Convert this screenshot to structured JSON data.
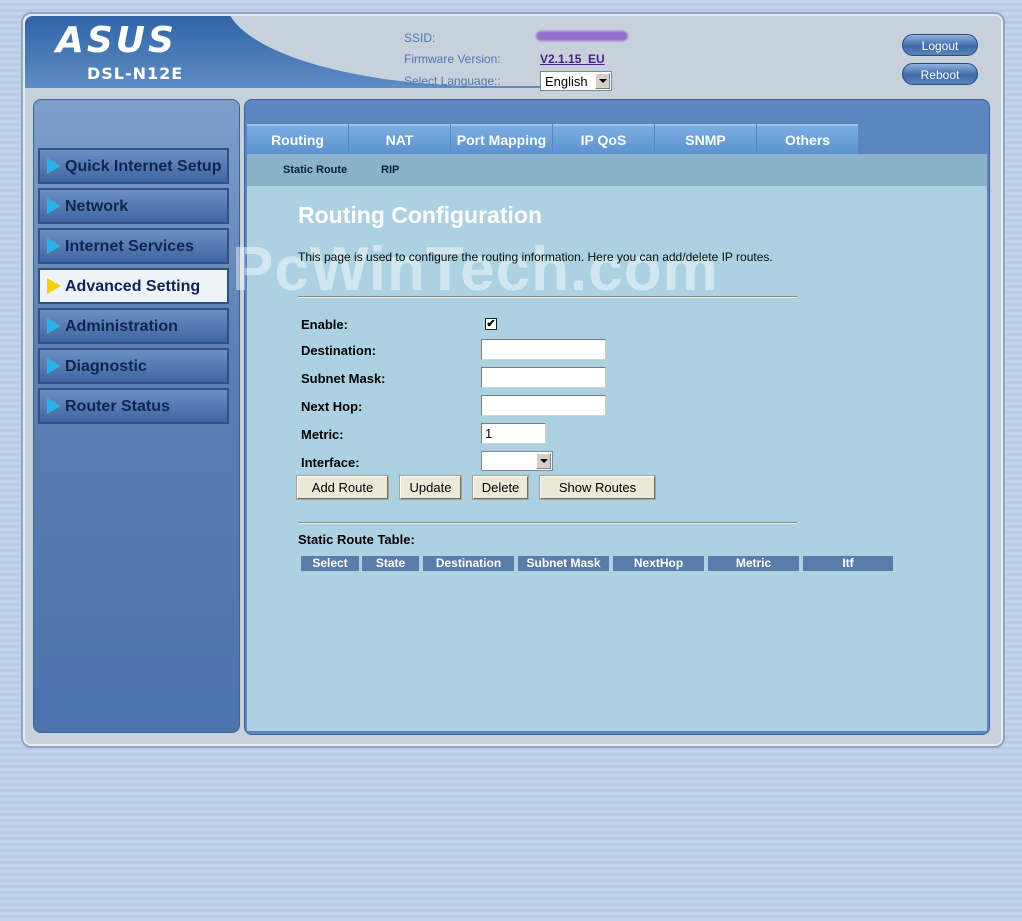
{
  "header": {
    "brand": "ASUS",
    "model": "DSL-N12E",
    "ssid_label": "SSID:",
    "firmware_label": "Firmware Version:",
    "firmware_value": "V2.1.15_EU",
    "language_label": "Select Language::",
    "language_value": "English",
    "logout_label": "Logout",
    "reboot_label": "Reboot"
  },
  "sidebar": {
    "items": [
      {
        "label": "Quick Internet Setup"
      },
      {
        "label": "Network"
      },
      {
        "label": "Internet Services"
      },
      {
        "label": "Advanced Setting"
      },
      {
        "label": "Administration"
      },
      {
        "label": "Diagnostic"
      },
      {
        "label": "Router Status"
      }
    ]
  },
  "tabs": [
    "Routing",
    "NAT",
    "Port Mapping",
    "IP QoS",
    "SNMP",
    "Others"
  ],
  "subtabs": [
    "Static Route",
    "RIP"
  ],
  "watermark": "PcWinTech.com",
  "page": {
    "title": "Routing Configuration",
    "description": "This page is used to configure the routing information. Here you can add/delete IP routes."
  },
  "form": {
    "enable_label": "Enable:",
    "enable_checked": "✔",
    "destination_label": "Destination:",
    "subnet_label": "Subnet Mask:",
    "nexthop_label": "Next Hop:",
    "metric_label": "Metric:",
    "metric_value": "1",
    "interface_label": "Interface:"
  },
  "buttons": {
    "add": "Add Route",
    "update": "Update",
    "delete": "Delete",
    "show": "Show Routes"
  },
  "table": {
    "label": "Static Route Table:",
    "headers": [
      "Select",
      "State",
      "Destination",
      "Subnet Mask",
      "NextHop",
      "Metric",
      "Itf"
    ]
  }
}
